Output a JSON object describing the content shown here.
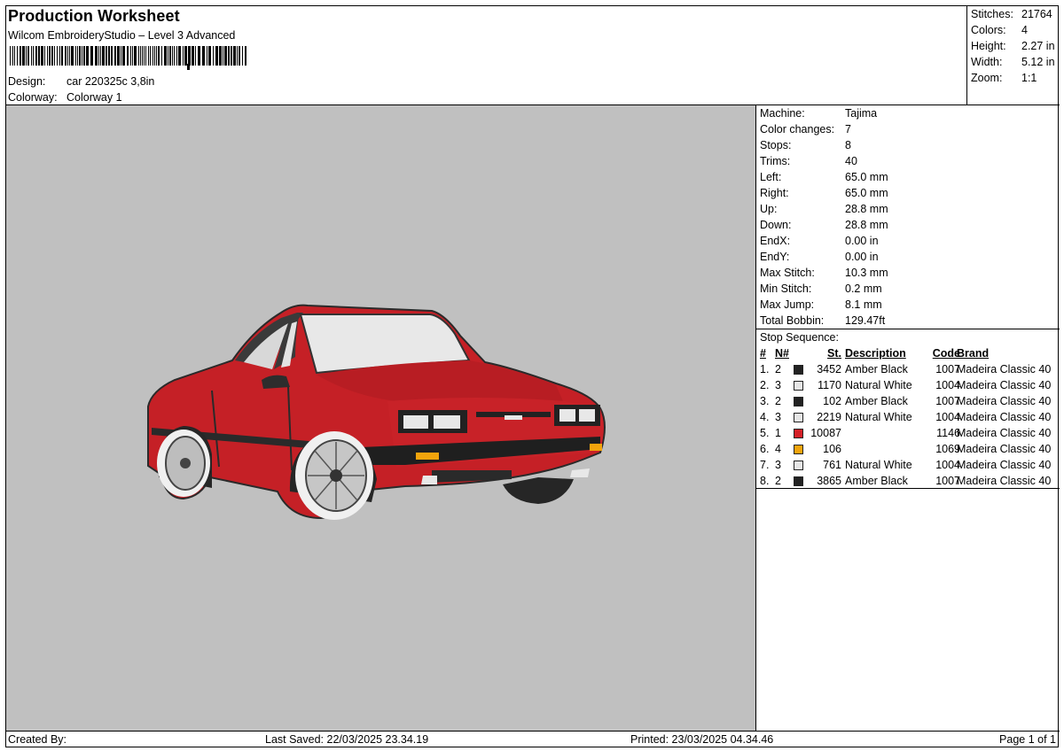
{
  "header": {
    "title": "Production Worksheet",
    "subtitle": "Wilcom EmbroideryStudio – Level 3 Advanced",
    "design_label": "Design:",
    "design_value": "car 220325c 3,8in",
    "colorway_label": "Colorway:",
    "colorway_value": "Colorway 1"
  },
  "stats": [
    {
      "label": "Stitches:",
      "value": "21764"
    },
    {
      "label": "Colors:",
      "value": "4"
    },
    {
      "label": "Height:",
      "value": "2.27 in"
    },
    {
      "label": "Width:",
      "value": "5.12 in"
    },
    {
      "label": "Zoom:",
      "value": "1:1"
    }
  ],
  "machine_info": [
    {
      "label": "Machine:",
      "value": "Tajima"
    },
    {
      "label": "Color changes:",
      "value": "7"
    },
    {
      "label": "Stops:",
      "value": "8"
    },
    {
      "label": "Trims:",
      "value": "40"
    },
    {
      "label": "Left:",
      "value": "65.0 mm"
    },
    {
      "label": "Right:",
      "value": "65.0 mm"
    },
    {
      "label": "Up:",
      "value": "28.8 mm"
    },
    {
      "label": "Down:",
      "value": "28.8 mm"
    },
    {
      "label": "EndX:",
      "value": "0.00 in"
    },
    {
      "label": "EndY:",
      "value": "0.00 in"
    },
    {
      "label": "Max Stitch:",
      "value": "10.3 mm"
    },
    {
      "label": "Min Stitch:",
      "value": "0.2 mm"
    },
    {
      "label": "Max Jump:",
      "value": "8.1 mm"
    },
    {
      "label": "Total Bobbin:",
      "value": "129.47ft"
    }
  ],
  "stop_sequence": {
    "title": "Stop Sequence:",
    "headers": {
      "num": "#",
      "n": "N#",
      "st": "St.",
      "desc": "Description",
      "code": "Code",
      "brand": "Brand"
    },
    "rows": [
      {
        "num": "1.",
        "n": "2",
        "color": "#222222",
        "st": "3452",
        "desc": "Amber Black",
        "code": "1007",
        "brand": "Madeira Classic 40"
      },
      {
        "num": "2.",
        "n": "3",
        "color": "#e6e6e6",
        "st": "1170",
        "desc": "Natural White",
        "code": "1004",
        "brand": "Madeira Classic 40"
      },
      {
        "num": "3.",
        "n": "2",
        "color": "#222222",
        "st": "102",
        "desc": "Amber Black",
        "code": "1007",
        "brand": "Madeira Classic 40"
      },
      {
        "num": "4.",
        "n": "3",
        "color": "#e6e6e6",
        "st": "2219",
        "desc": "Natural White",
        "code": "1004",
        "brand": "Madeira Classic 40"
      },
      {
        "num": "5.",
        "n": "1",
        "color": "#d42027",
        "st": "10087",
        "desc": "",
        "code": "1146",
        "brand": "Madeira Classic 40"
      },
      {
        "num": "6.",
        "n": "4",
        "color": "#f2a40c",
        "st": "106",
        "desc": "",
        "code": "1069",
        "brand": "Madeira Classic 40"
      },
      {
        "num": "7.",
        "n": "3",
        "color": "#e6e6e6",
        "st": "761",
        "desc": "Natural White",
        "code": "1004",
        "brand": "Madeira Classic 40"
      },
      {
        "num": "8.",
        "n": "2",
        "color": "#222222",
        "st": "3865",
        "desc": "Amber Black",
        "code": "1007",
        "brand": "Madeira Classic 40"
      }
    ]
  },
  "footer": {
    "created_by": "Created By:",
    "last_saved": "Last Saved: 22/03/2025 23.34.19",
    "printed": "Printed: 23/03/2025 04.34.46",
    "page": "Page 1 of 1"
  },
  "preview": {
    "background": "#c0c0c0",
    "car_color": "#d42027"
  }
}
